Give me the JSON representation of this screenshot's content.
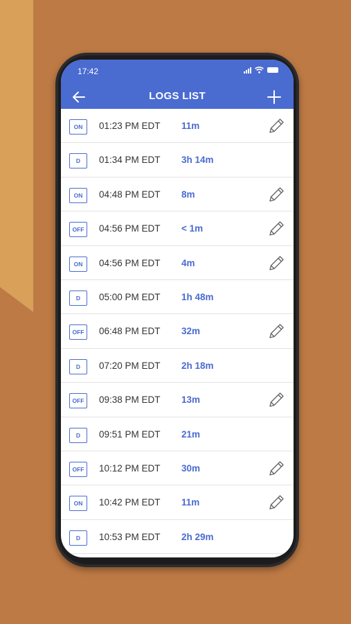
{
  "status_bar": {
    "time": "17:42"
  },
  "header": {
    "title": "LOGS LIST",
    "back_icon": "arrow-left-icon",
    "add_icon": "plus-icon"
  },
  "colors": {
    "accent": "#4A6BD0",
    "background": "#BE7A45",
    "decor": "#D9A05A"
  },
  "logs": [
    {
      "status": "ON",
      "time": "01:23 PM EDT",
      "duration": "11m",
      "editable": true
    },
    {
      "status": "D",
      "time": "01:34 PM EDT",
      "duration": "3h 14m",
      "editable": false
    },
    {
      "status": "ON",
      "time": "04:48 PM EDT",
      "duration": "8m",
      "editable": true
    },
    {
      "status": "OFF",
      "time": "04:56 PM EDT",
      "duration": "< 1m",
      "editable": true
    },
    {
      "status": "ON",
      "time": "04:56 PM EDT",
      "duration": "4m",
      "editable": true
    },
    {
      "status": "D",
      "time": "05:00 PM EDT",
      "duration": "1h 48m",
      "editable": false
    },
    {
      "status": "OFF",
      "time": "06:48 PM EDT",
      "duration": "32m",
      "editable": true
    },
    {
      "status": "D",
      "time": "07:20 PM EDT",
      "duration": "2h 18m",
      "editable": false
    },
    {
      "status": "OFF",
      "time": "09:38 PM EDT",
      "duration": "13m",
      "editable": true
    },
    {
      "status": "D",
      "time": "09:51 PM EDT",
      "duration": "21m",
      "editable": false
    },
    {
      "status": "OFF",
      "time": "10:12 PM EDT",
      "duration": "30m",
      "editable": true
    },
    {
      "status": "ON",
      "time": "10:42 PM EDT",
      "duration": "11m",
      "editable": true
    },
    {
      "status": "D",
      "time": "10:53 PM EDT",
      "duration": "2h 29m",
      "editable": false
    }
  ]
}
